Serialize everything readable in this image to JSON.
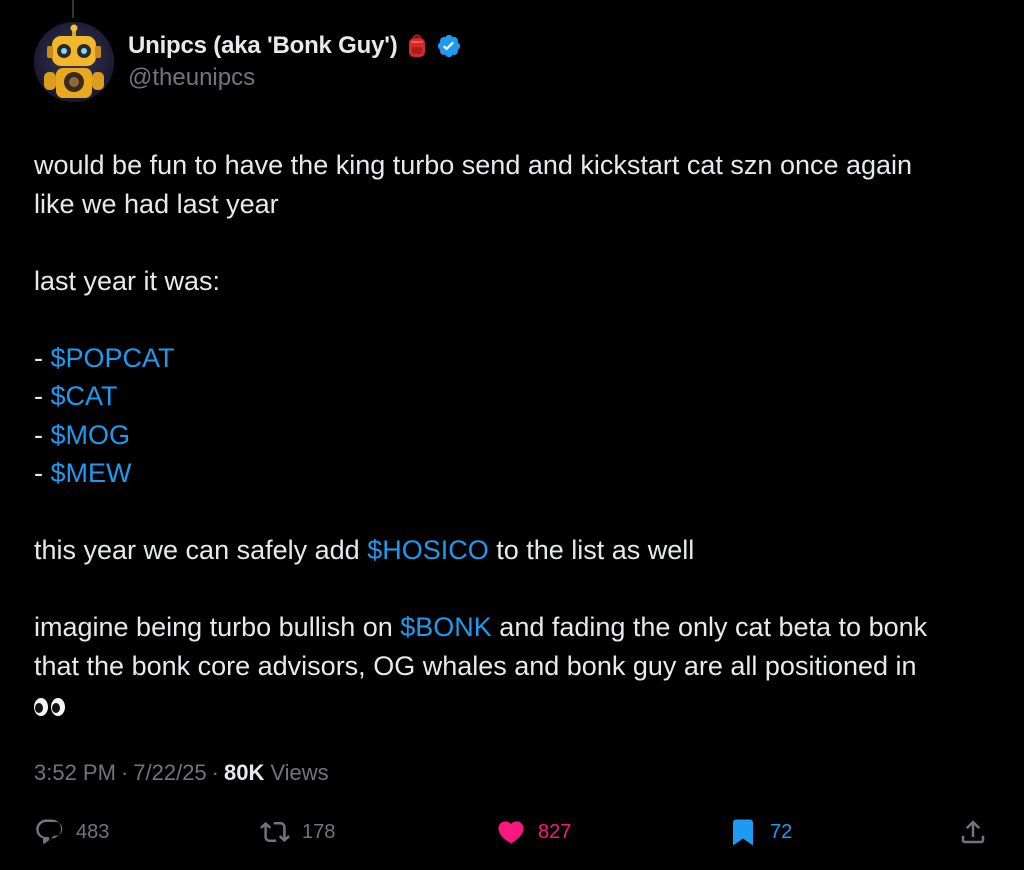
{
  "author": {
    "display_name": "Unipcs (aka 'Bonk Guy')",
    "handle": "@theunipcs",
    "badge_icon": "backpack-icon",
    "verified_icon": "verified-badge-icon",
    "verified_color": "#1d9bf0"
  },
  "tweet": {
    "line1": "would be fun to have the king turbo send and kickstart cat szn once again",
    "line2": "like we had last year",
    "line3": "last year it was:",
    "list": [
      {
        "prefix": "- ",
        "tag": "$POPCAT"
      },
      {
        "prefix": "- ",
        "tag": "$CAT"
      },
      {
        "prefix": "- ",
        "tag": "$MOG"
      },
      {
        "prefix": "- ",
        "tag": "$MEW"
      }
    ],
    "hosico_pre": "this year we can safely add ",
    "hosico_tag": "$HOSICO",
    "hosico_post": " to the list as well",
    "bonk_pre": "imagine being turbo bullish on ",
    "bonk_tag": "$BONK",
    "bonk_post": " and fading the only cat beta to bonk",
    "bonk_line2": "that the bonk core advisors, OG whales and bonk guy are all positioned in",
    "eyes_icon": "eyes-emoji-icon",
    "cashtag_color": "#1d9bf0"
  },
  "meta": {
    "time": "3:52 PM",
    "separator": "·",
    "date": "7/22/25",
    "views_count": "80K",
    "views_label": "Views"
  },
  "actions": {
    "reply_count": "483",
    "retweet_count": "178",
    "like_count": "827",
    "bookmark_count": "72",
    "like_color": "#f91880",
    "bookmark_color": "#1d9bf0"
  }
}
